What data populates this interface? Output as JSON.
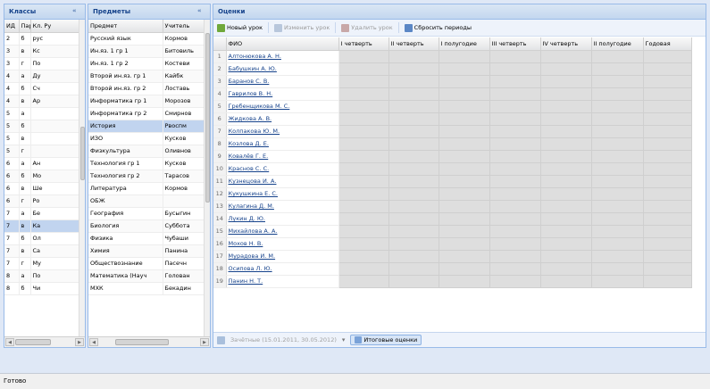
{
  "classes_panel": {
    "title": "Классы",
    "columns": [
      "ИД",
      "Пара",
      "Кл. Ру"
    ],
    "rows": [
      [
        "2",
        "б",
        "рус"
      ],
      [
        "3",
        "в",
        "Кс"
      ],
      [
        "3",
        "г",
        "По"
      ],
      [
        "4",
        "а",
        "Ду"
      ],
      [
        "4",
        "б",
        "Сч"
      ],
      [
        "4",
        "в",
        "Ар"
      ],
      [
        "5",
        "а",
        ""
      ],
      [
        "5",
        "б",
        ""
      ],
      [
        "5",
        "в",
        ""
      ],
      [
        "5",
        "г",
        ""
      ],
      [
        "6",
        "а",
        "Ан"
      ],
      [
        "6",
        "б",
        "Мо"
      ],
      [
        "6",
        "в",
        "Ше"
      ],
      [
        "6",
        "г",
        "Ро"
      ],
      [
        "7",
        "а",
        "Бе"
      ],
      [
        "7",
        "в",
        "Ка"
      ],
      [
        "7",
        "б",
        "Ол"
      ],
      [
        "7",
        "в",
        "Са"
      ],
      [
        "7",
        "г",
        "Му"
      ],
      [
        "8",
        "а",
        "По"
      ],
      [
        "8",
        "б",
        "Чи"
      ]
    ]
  },
  "subjects_panel": {
    "title": "Предметы",
    "columns": [
      "Предмет",
      "Учитель"
    ],
    "rows": [
      [
        "Русский язык",
        "Кормов"
      ],
      [
        "Ин.яз. 1 гр 1",
        "Битовиль"
      ],
      [
        "Ин.яз. 1 гр 2",
        "Костеви"
      ],
      [
        "Второй ин.яз. гр 1",
        "Кайбк"
      ],
      [
        "Второй ин.яз. гр 2",
        "Лоставь"
      ],
      [
        "Информатика гр 1",
        "Морозов"
      ],
      [
        "Информатика гр 2",
        "Смирнов"
      ],
      [
        "История",
        "Рвоспм"
      ],
      [
        "ИЗО",
        "Кусков"
      ],
      [
        "Физкультура",
        "Оливнов"
      ],
      [
        "Технология гр 1",
        "Кусков"
      ],
      [
        "Технология гр 2",
        "Тарасов"
      ],
      [
        "Литература",
        "Кормов"
      ],
      [
        "ОБЖ",
        ""
      ],
      [
        "География",
        "Бусыгин"
      ],
      [
        "Биология",
        "Суббота"
      ],
      [
        "Физика",
        "Чубаши"
      ],
      [
        "Химия",
        "Панина"
      ],
      [
        "Обществознание",
        "Пасечн"
      ],
      [
        "Математика (Науч",
        "Голован"
      ],
      [
        "МХК",
        "Бекадин"
      ]
    ]
  },
  "grades_panel": {
    "title": "Оценки",
    "toolbar": {
      "new_grade": "Новый урок",
      "edit_grade": "Изменить урок",
      "delete_grade": "Удалить урок",
      "reset_periods": "Сбросить периоды"
    },
    "columns": [
      "ФИО",
      "I четверть",
      "II четверть",
      "I полугодие",
      "III четверть",
      "IV четверть",
      "II полугодие",
      "Годовая"
    ],
    "students": [
      "Алтонюкова А. Н.",
      "Бабушкин А. Ю.",
      "Баранов С. В.",
      "Гаврилов В. Н.",
      "Гребенщикова М. С.",
      "Жидкова А. В.",
      "Колпакова Ю. М.",
      "Козлова Д. Е.",
      "Ковалёв Г. Е.",
      "Краснов С. С.",
      "Кузнецова И. А.",
      "Кукушкина Е. С.",
      "Кулагина Д. М.",
      "Лукин Д. Ю.",
      "Михайлова А. А.",
      "Мохов Н. В.",
      "Мурадова И. М.",
      "Осипова Л. Ю.",
      "Панин Н. Т."
    ],
    "bottom_text": "Зачётные (15.01.2011, 30.05.2012)",
    "final_grades_button": "Итоговые оценки"
  },
  "status_bar": {
    "text": "Готово"
  },
  "colors": {
    "panel_border": "#99bbe8",
    "header_text": "#15428b",
    "grade_cell": "#dedede",
    "selected_row": "#dfe8f6"
  }
}
